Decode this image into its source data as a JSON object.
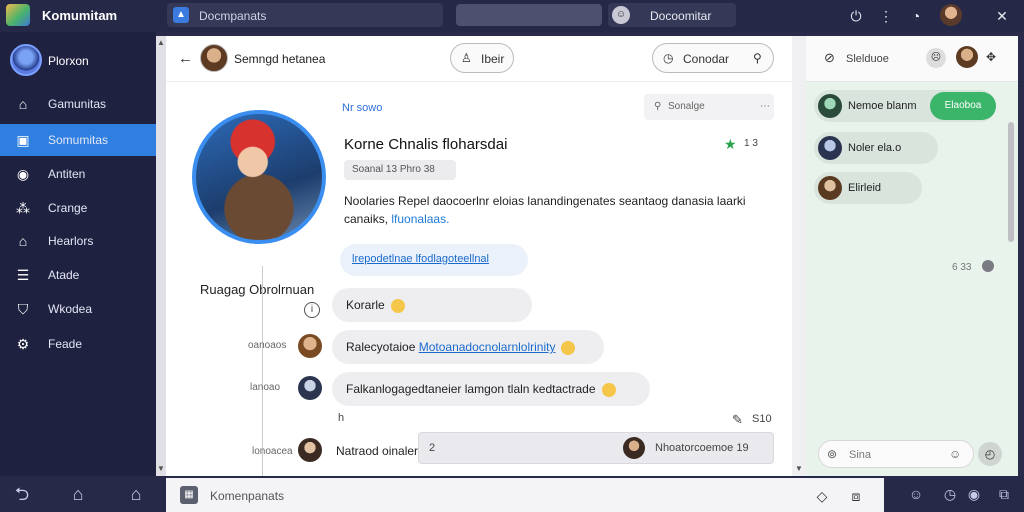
{
  "topbar": {
    "app_title": "Komumitam",
    "tab_label": "Docmpanats",
    "user_label": "Docoomitar"
  },
  "sidebar": {
    "profile_name": "Plorxon",
    "items": [
      {
        "label": "Gamunitas",
        "icon": "home-icon",
        "active": false
      },
      {
        "label": "Somumitas",
        "icon": "image-icon",
        "active": true
      },
      {
        "label": "Antiten",
        "icon": "chat-icon",
        "active": false
      },
      {
        "label": "Crange",
        "icon": "network-icon",
        "active": false
      },
      {
        "label": "Hearlors",
        "icon": "house-icon",
        "active": false
      },
      {
        "label": "Atade",
        "icon": "list-icon",
        "active": false
      },
      {
        "label": "Wkodea",
        "icon": "shield-icon",
        "active": false
      },
      {
        "label": "Feade",
        "icon": "gear-icon",
        "active": false
      }
    ]
  },
  "chat": {
    "header_name": "Semngd hetanea",
    "btn_follow": "Ibeir",
    "btn_contact": "Conodar",
    "profile_big_name": "Ruagag Obrolrnuan",
    "nr_label": "Nr sowo",
    "search_label": "Sonalge",
    "post_title": "Korne Chnalis floharsdai",
    "star_count": "1 3",
    "tag_label": "Soanal 13 Phro 38",
    "body_text": "Noolaries Repel daocoerlnr eloias lanandingenates seantaog danasia laarki canaiks,",
    "body_link": "lfuonalaas.",
    "link_bubble": "lrepodetlnae lfodlagoteellnal",
    "messages": [
      {
        "side": "",
        "text": "Korarle",
        "link": ""
      },
      {
        "side": "oanoaos",
        "text": "Ralecyotaioe",
        "link": "Motoanadocnolarnlolrinity"
      },
      {
        "side": "lanoao",
        "text": "Falkanlogagedtaneier lamgon tlaln kedtactrade",
        "link": ""
      }
    ],
    "misc_left": "h",
    "edit_count": "S10",
    "last_side": "lonoacea",
    "last_name": "Natraod oinaler",
    "last_num": "2",
    "last_right": "Nhoatorcoemoe 19"
  },
  "composer": {
    "placeholder": "Komenpanats"
  },
  "right": {
    "header_title": "Slelduoe",
    "chats": [
      {
        "name": "Nemoe blanm"
      },
      {
        "name": "Noler ela.o"
      },
      {
        "name": "Elirleid"
      }
    ],
    "green_label": "Elaoboa",
    "time_label": "6 33",
    "input_placeholder": "Sina"
  },
  "colors": {
    "accent": "#2f7fe0",
    "green": "#3bb56a",
    "sidebar_bg": "#1f2140"
  }
}
